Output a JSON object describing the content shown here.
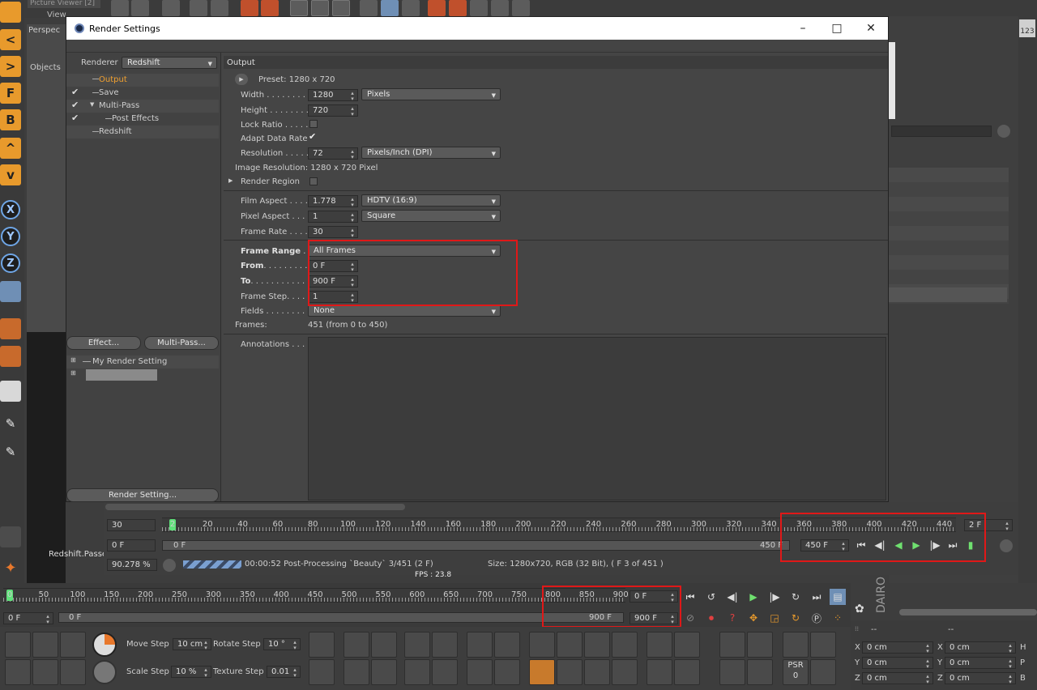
{
  "background_tabs": {
    "picture_viewer": "Picture Viewer [2]",
    "view_menu": "View",
    "perspective": "Perspec",
    "objects": "Objects"
  },
  "dialog": {
    "title": "Render Settings",
    "renderer_label": "Renderer",
    "renderer_value": "Redshift",
    "tree": [
      {
        "label": "Output",
        "checked": false,
        "active": true
      },
      {
        "label": "Save",
        "checked": true,
        "active": false
      },
      {
        "label": "Multi-Pass",
        "checked": true,
        "active": false
      },
      {
        "label": "Post Effects",
        "checked": true,
        "active": false
      },
      {
        "label": "Redshift",
        "checked": false,
        "active": false
      }
    ],
    "effect_button": "Effect...",
    "multipass_button": "Multi-Pass...",
    "setting_name": "My Render Setting",
    "render_setting_button": "Render Setting...",
    "section_header": "Output",
    "preset": "Preset: 1280 x 720",
    "width_label": "Width . . . . . . . . .",
    "width_value": "1280",
    "width_unit": "Pixels",
    "height_label": "Height . . . . . . . .",
    "height_value": "720",
    "lock_ratio_label": "Lock Ratio . . . . .",
    "adapt_label": "Adapt Data Rate",
    "resolution_label": "Resolution . . . . .",
    "resolution_value": "72",
    "resolution_unit": "Pixels/Inch (DPI)",
    "image_resolution": "Image Resolution: 1280 x 720 Pixel",
    "render_region_label": "Render Region",
    "film_aspect_label": "Film Aspect . . . .",
    "film_aspect_value": "1.778",
    "film_aspect_preset": "HDTV (16:9)",
    "pixel_aspect_label": "Pixel Aspect . . . .",
    "pixel_aspect_value": "1",
    "pixel_aspect_preset": "Square",
    "frame_rate_label": "Frame Rate . . . . .",
    "frame_rate_value": "30",
    "frame_range_label": "Frame Range",
    "frame_range_dots": ". . .",
    "frame_range_value": "All Frames",
    "from_label": "From",
    "from_dots": ". . . . . . . . .",
    "from_value": "0 F",
    "to_label": "To",
    "to_dots": ". . . . . . . . . . .",
    "to_value": "900 F",
    "frame_step_label": "Frame Step. . . .",
    "frame_step_value": "1",
    "fields_label": "Fields . . . . . . . . .",
    "fields_value": "None",
    "frames_label": "Frames:",
    "frames_value": "451 (from 0 to 450)",
    "annotations_label": "Annotations . . ."
  },
  "picture_viewer_bar": {
    "fps_field": "30",
    "frame_field": "0 F",
    "ruler_ticks": [
      "2",
      "20",
      "40",
      "60",
      "80",
      "100",
      "120",
      "140",
      "160",
      "180",
      "200",
      "220",
      "240",
      "260",
      "280",
      "300",
      "320",
      "340",
      "360",
      "380",
      "400",
      "420",
      "440"
    ],
    "current_frame": "2 F",
    "range_start": "0 F",
    "range_end": "450 F",
    "end_field": "450 F",
    "zoom": "90.278 %",
    "status": "00:00:52 Post-Processing `Beauty` 3/451 (2 F)",
    "size_info": "Size: 1280x720, RGB (32 Bit),  ( F 3 of 451 )",
    "fps_overlay": "FPS : 23.8"
  },
  "main_timeline": {
    "ruler_ticks": [
      "0",
      "50",
      "100",
      "150",
      "200",
      "250",
      "300",
      "350",
      "400",
      "450",
      "500",
      "550",
      "600",
      "650",
      "700",
      "750",
      "800",
      "850",
      "900"
    ],
    "start_field": "0 F",
    "range_start": "0 F",
    "range_end": "900 F",
    "current_field": "0 F",
    "end_field": "900 F"
  },
  "bottom_bar": {
    "move_step_label": "Move Step",
    "move_step_value": "10 cm",
    "rotate_step_label": "Rotate Step",
    "rotate_step_value": "10 °",
    "scale_step_label": "Scale Step",
    "scale_step_value": "10 %",
    "texture_step_label": "Texture Step",
    "texture_step_value": "0.01",
    "psr_label": "PSR",
    "psr_value": "0"
  },
  "coords": {
    "x_label": "X",
    "y_label": "Y",
    "z_label": "Z",
    "x_value": "0 cm",
    "y_value": "0 cm",
    "z_value": "0 cm",
    "x2_label": "X",
    "y2_label": "Y",
    "z2_label": "Z",
    "x2_value": "0 cm",
    "y2_value": "0 cm",
    "z2_value": "0 cm",
    "h_label": "H",
    "p_label": "P",
    "b_label": "B",
    "dash1": "--",
    "dash2": "--"
  },
  "side_text": {
    "dairo": "DAIRO",
    "redshift_pass": "Redshift.Passes"
  },
  "colors": {
    "accent_orange": "#e89a2c",
    "highlight_red": "#e01818",
    "dialog_bg": "#454545",
    "active_item": "#f0a030"
  }
}
